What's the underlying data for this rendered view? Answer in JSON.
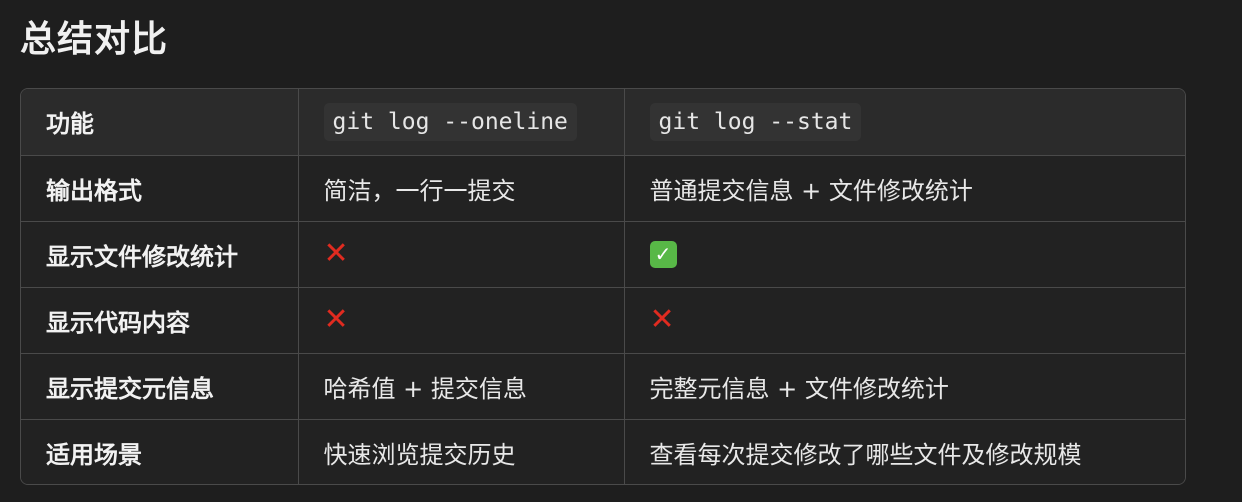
{
  "title": "总结对比",
  "table": {
    "headers": [
      "功能",
      "git log --oneline",
      "git log --stat"
    ],
    "rows": [
      {
        "feature": "输出格式",
        "oneline": "简洁，一行一提交",
        "stat": "普通提交信息 + 文件修改统计"
      },
      {
        "feature": "显示文件修改统计",
        "oneline": "❌",
        "stat": "✅"
      },
      {
        "feature": "显示代码内容",
        "oneline": "❌",
        "stat": "❌"
      },
      {
        "feature": "显示提交元信息",
        "oneline": "哈希值 + 提交信息",
        "stat": "完整元信息 + 文件修改统计"
      },
      {
        "feature": "适用场景",
        "oneline": "快速浏览提交历史",
        "stat": "查看每次提交修改了哪些文件及修改规模"
      }
    ]
  },
  "colors": {
    "background": "#1e1e1e",
    "cross": "#e02b20",
    "check": "#58b847",
    "border": "#4a4a4a"
  }
}
